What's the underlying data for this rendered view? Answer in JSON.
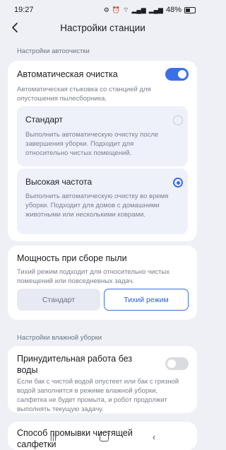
{
  "status": {
    "time": "19:27",
    "battery": "48%"
  },
  "header": {
    "title": "Настройки станции"
  },
  "auto_section": {
    "label": "Настройки автоочистки"
  },
  "auto_card": {
    "title": "Автоматическая очистка",
    "toggle_on": true,
    "description": "Автоматическая стыковка со станцией для опустошения пылесборника.",
    "options": [
      {
        "title": "Стандарт",
        "description": "Выполнить автоматическую очистку после завершения уборки. Подходит для относительно чистых помещений.",
        "selected": false
      },
      {
        "title": "Высокая частота",
        "description": "Выполнить автоматическую очистку во время уборки. Подходит для домов с домашними животными или несколькими коврами.",
        "selected": true
      }
    ]
  },
  "power_card": {
    "title": "Мощность при сборе пыли",
    "description": "Тихий режим подходит для относительно чистых помещений или повседневных задач.",
    "buttons": [
      {
        "label": "Стандарт",
        "active": false
      },
      {
        "label": "Тихий режим",
        "active": true
      }
    ]
  },
  "wet_section": {
    "label": "Настройки влажной уборки"
  },
  "forced_card": {
    "title": "Принудительная работа без воды",
    "toggle_on": false,
    "description": "Если бак с чистой водой опустеет или бак с грязной водой заполнится в режиме влажной уборки, салфетка не будет промыта, и робот продолжит выполнять текущую задачу."
  },
  "wash_card": {
    "title": "Способ промывки чистящей салфетки"
  },
  "colors": {
    "accent": "#3b6fe6",
    "background": "#eef0f6"
  }
}
